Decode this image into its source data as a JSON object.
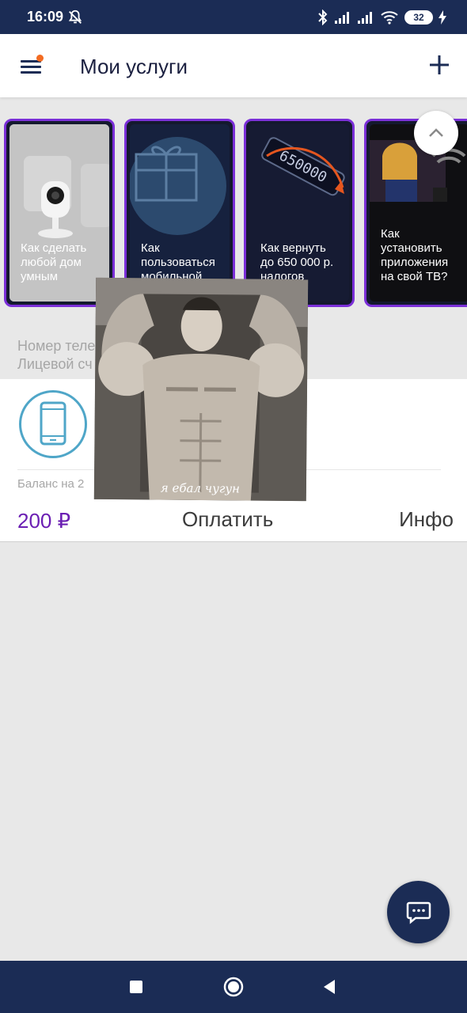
{
  "status_bar": {
    "time": "16:09",
    "battery": "32"
  },
  "app_bar": {
    "title": "Мои услуги"
  },
  "cards": [
    {
      "text": "Как сделать любой дом умным"
    },
    {
      "text": "Как пользоваться мобильной"
    },
    {
      "text": "Как вернуть до 650 000 р. налогов"
    },
    {
      "text": "Как установить приложения на свой ТВ?"
    }
  ],
  "card_art": {
    "counter": "650000"
  },
  "info": {
    "phone_label": "Номер теле",
    "account_label": "Лицевой сч"
  },
  "account": {
    "balance_label": "Баланс на 2",
    "balance_amount": "200 ₽",
    "pay_label": "Оплатить",
    "info_label": "Инфо"
  },
  "meme": {
    "caption": "я ебал чугун"
  },
  "colors": {
    "primary_dark": "#1b2c55",
    "accent_purple": "#7b2fd8",
    "balance_purple": "#6b1fb3",
    "notification_orange": "#f36b21",
    "phone_icon_blue": "#4fa6c8"
  }
}
